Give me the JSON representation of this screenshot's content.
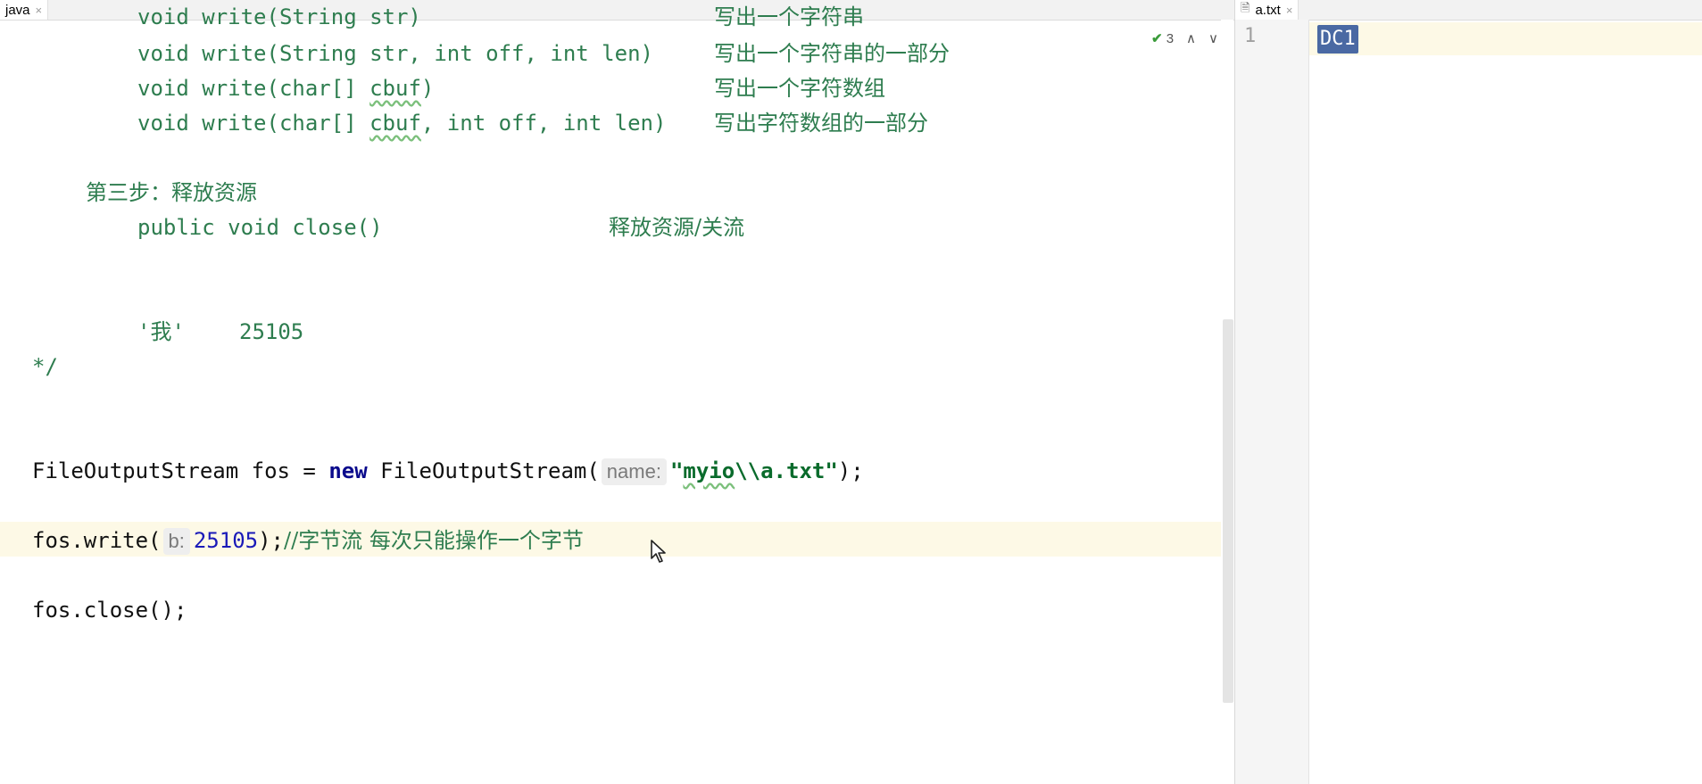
{
  "left_tab": {
    "label": "java",
    "close": "×"
  },
  "right_tab": {
    "label": "a.txt",
    "close": "×"
  },
  "inspection": {
    "count": "3",
    "up": "∧",
    "down": "∨"
  },
  "code": {
    "line_write_str_top": "void write(String str)",
    "line_write_str_top_comment": "写出一个字符串",
    "line_write_str_off_code": "void write(String str, int off, int len)",
    "line_write_str_off_comment": "写出一个字符串的一部分",
    "line_write_char_prefix": "void write(char[] ",
    "line_write_char_param": "cbuf",
    "line_write_char_suffix": ")",
    "line_write_char_comment": "写出一个字符数组",
    "line_write_char_off_prefix": "void write(char[] ",
    "line_write_char_off_param": "cbuf",
    "line_write_char_off_suffix": ", int off, int len)",
    "line_write_char_off_comment": "写出字符数组的一部分",
    "step3_title": "第三步：释放资源",
    "close_sig": "public void close()",
    "close_comment": "释放资源/关流",
    "char_literal": "'我'",
    "char_code": "25105",
    "comment_end": "*/",
    "fos_type": "FileOutputStream",
    "fos_var": " fos = ",
    "fos_new": "new",
    "fos_ctor": " FileOutputStream(",
    "fos_hint": "name:",
    "fos_str_open": "\"",
    "fos_str_path": "myio",
    "fos_str_rest": "\\\\a.txt\"",
    "fos_end": ");",
    "write_call": "fos.write(",
    "write_hint": "b:",
    "write_num": "25105",
    "write_end": ");",
    "write_comment": "//字节流 每次只能操作一个字节",
    "close_call": "fos.close();"
  },
  "line_number": "1",
  "file_content": "DC1"
}
